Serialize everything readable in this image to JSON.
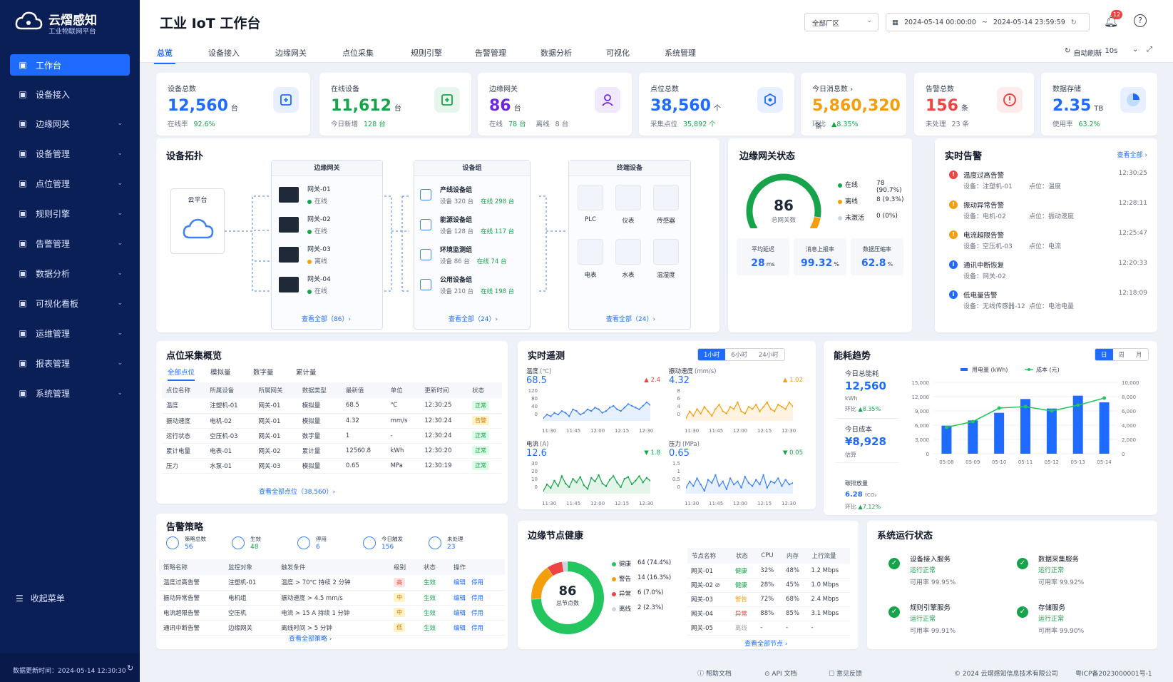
{
  "brand": {
    "name": "云熠感知",
    "subtitle": "工业物联网平台"
  },
  "sidebar": {
    "items": [
      {
        "label": "工作台",
        "icon": "dashboard-icon",
        "active": true
      },
      {
        "label": "设备接入",
        "icon": "device-access-icon"
      },
      {
        "label": "边缘网关",
        "icon": "gateway-icon",
        "chevron": true
      },
      {
        "label": "设备管理",
        "icon": "device-manage-icon",
        "chevron": true
      },
      {
        "label": "点位管理",
        "icon": "point-icon",
        "chevron": true
      },
      {
        "label": "规则引擎",
        "icon": "rule-icon",
        "chevron": true
      },
      {
        "label": "告警管理",
        "icon": "alarm-icon",
        "chevron": true
      },
      {
        "label": "数据分析",
        "icon": "analysis-icon",
        "chevron": true
      },
      {
        "label": "可视化看板",
        "icon": "board-icon",
        "chevron": true
      },
      {
        "label": "运维管理",
        "icon": "ops-icon",
        "chevron": true
      },
      {
        "label": "报表管理",
        "icon": "report-icon",
        "chevron": true
      },
      {
        "label": "系统管理",
        "icon": "settings-icon",
        "chevron": true
      }
    ],
    "collapse_label": "收起菜单",
    "update_time": "数据更新时间：2024-05-14 12:30:30"
  },
  "header": {
    "title": "工业 IoT 工作台",
    "factory_select": "全部厂区",
    "date_start": "2024-05-14 00:00:00",
    "date_sep": "~",
    "date_end": "2024-05-14 23:59:59",
    "notif_count": "12"
  },
  "tabs": [
    "总览",
    "设备接入",
    "边缘网关",
    "点位采集",
    "规则引擎",
    "告警管理",
    "数据分析",
    "可视化",
    "系统管理"
  ],
  "refresh": {
    "label": "自动刷新",
    "interval": "10s"
  },
  "stats": [
    {
      "label": "设备总数",
      "value": "12,560",
      "unit": "台",
      "sub1": "在线率",
      "sub1v": "92.6%",
      "sub2": "",
      "sub2v": "",
      "color": "#1f6bff",
      "icon": "device-icon"
    },
    {
      "label": "在线设备",
      "value": "11,612",
      "unit": "台",
      "sub1": "今日新增",
      "sub1v": "128 台",
      "sub2": "",
      "sub2v": "",
      "color": "#16a34a",
      "icon": "online-icon"
    },
    {
      "label": "边缘网关",
      "value": "86",
      "unit": "台",
      "sub1": "在线",
      "sub1v": "78 台",
      "sub2": "离线",
      "sub2v": "8 台",
      "color": "#6d28d9",
      "icon": "gateway-user-icon"
    },
    {
      "label": "点位总数",
      "value": "38,560",
      "unit": "个",
      "sub1": "采集点位",
      "sub1v": "35,892 个",
      "sub2": "",
      "sub2v": "",
      "color": "#1f6bff",
      "icon": "point-hex-icon"
    },
    {
      "label": "今日消息数 ›",
      "value": "5,860,320",
      "unit": "条",
      "sub1": "环比",
      "sub1v": "▲8.35%",
      "sub2": "",
      "sub2v": "",
      "color": "#f59e0b",
      "icon": ""
    },
    {
      "label": "告警总数",
      "value": "156",
      "unit": "条",
      "sub1": "未处理",
      "sub1v": "23 条",
      "sub2": "",
      "sub2v": "",
      "color": "#ef4444",
      "icon": "alert-circle-icon"
    },
    {
      "label": "数据存储",
      "value": "2.35",
      "unit": "TB",
      "sub1": "使用率",
      "sub1v": "63.2%",
      "sub2": "",
      "sub2v": "",
      "color": "#1f6bff",
      "icon": "storage-pie-icon"
    }
  ],
  "topology": {
    "title": "设备拓扑",
    "cloud": "云平台",
    "gateway_head": "边缘网关",
    "gateways": [
      {
        "name": "网关-01",
        "status": "在线",
        "color": "#16a34a"
      },
      {
        "name": "网关-02",
        "status": "在线",
        "color": "#16a34a"
      },
      {
        "name": "网关-03",
        "status": "离线",
        "color": "#f59e0b"
      },
      {
        "name": "网关-04",
        "status": "在线",
        "color": "#16a34a"
      }
    ],
    "gateway_link": "查看全部（86）›",
    "group_head": "设备组",
    "groups": [
      {
        "name": "产线设备组",
        "dev": "设备 320 台",
        "online": "在线 298 台"
      },
      {
        "name": "能源设备组",
        "dev": "设备 128 台",
        "online": "在线 117 台"
      },
      {
        "name": "环境监测组",
        "dev": "设备 86 台",
        "online": "在线 74 台"
      },
      {
        "name": "公用设备组",
        "dev": "设备 210 台",
        "online": "在线 198 台"
      }
    ],
    "group_link": "查看全部（24）›",
    "terminal_head": "终端设备",
    "terminals": [
      "PLC",
      "仪表",
      "传感器",
      "电表",
      "水表",
      "温湿度"
    ],
    "terminal_link": "查看全部（24）›"
  },
  "gw_status": {
    "title": "边缘网关状态",
    "total": "86",
    "total_label": "总网关数",
    "legend": [
      {
        "label": "在线",
        "value": "78 (90.7%)",
        "color": "#16a34a"
      },
      {
        "label": "离线",
        "value": "8 (9.3%)",
        "color": "#f59e0b"
      },
      {
        "label": "未激活",
        "value": "0 (0%)",
        "color": "#cbd5e1"
      }
    ],
    "online_fraction": 0.907,
    "metrics": [
      {
        "label": "平均延迟",
        "value": "28",
        "unit": "ms"
      },
      {
        "label": "消息上报率",
        "value": "99.32",
        "unit": "%"
      },
      {
        "label": "数据压缩率",
        "value": "62.8",
        "unit": "%"
      }
    ]
  },
  "alarms": {
    "title": "实时告警",
    "more": "查看全部 ›",
    "items": [
      {
        "title": "温度过高告警",
        "device": "设备：注塑机-01",
        "point": "点位：温度",
        "time": "12:30:25",
        "color": "#ef4444",
        "sym": "!"
      },
      {
        "title": "振动异常告警",
        "device": "设备：电机-02",
        "point": "点位：振动速度",
        "time": "12:28:11",
        "color": "#f59e0b",
        "sym": "!"
      },
      {
        "title": "电流超限告警",
        "device": "设备：空压机-03",
        "point": "点位：电流",
        "time": "12:25:47",
        "color": "#f59e0b",
        "sym": "!"
      },
      {
        "title": "通讯中断恢复",
        "device": "设备：网关-02",
        "point": "",
        "time": "12:20:33",
        "color": "#1f6bff",
        "sym": "i"
      },
      {
        "title": "低电量告警",
        "device": "设备：无线传感器-12",
        "point": "点位：电池电量",
        "time": "12:18:09",
        "color": "#1f6bff",
        "sym": "i"
      }
    ]
  },
  "points": {
    "title": "点位采集概览",
    "tabs": [
      "全部点位",
      "模拟量",
      "数字量",
      "累计量"
    ],
    "headers": [
      "点位名称",
      "所属设备",
      "所属网关",
      "数据类型",
      "最新值",
      "单位",
      "更新时间",
      "状态"
    ],
    "rows": [
      [
        "温度",
        "注塑机-01",
        "网关-01",
        "模拟量",
        "68.5",
        "℃",
        "12:30:25",
        "正常"
      ],
      [
        "振动速度",
        "电机-02",
        "网关-01",
        "模拟量",
        "4.32",
        "mm/s",
        "12:30:24",
        "告警"
      ],
      [
        "运行状态",
        "空压机-03",
        "网关-01",
        "数字量",
        "1",
        "-",
        "12:30:24",
        "正常"
      ],
      [
        "累计电量",
        "电表-01",
        "网关-02",
        "累计量",
        "12560.8",
        "kWh",
        "12:30:20",
        "正常"
      ],
      [
        "压力",
        "水泵-01",
        "网关-03",
        "模拟量",
        "0.65",
        "MPa",
        "12:30:19",
        "正常"
      ]
    ],
    "more": "查看全部点位（38,560）›"
  },
  "telemetry": {
    "title": "实时遥测",
    "ranges": [
      "1小时",
      "6小时",
      "24小时"
    ],
    "charts": [
      {
        "label": "温度",
        "unit": "(℃)",
        "value": "68.5",
        "delta": "▲ 2.4",
        "dcolor": "#ef4444",
        "color": "#3b82f6",
        "yticks": [
          "120",
          "80",
          "40",
          "0"
        ],
        "x": [
          "11:30",
          "11:45",
          "12:00",
          "12:15",
          "12:30"
        ],
        "values": [
          61,
          63,
          62,
          64,
          63,
          65,
          64,
          62,
          66,
          65,
          63,
          64,
          66,
          65,
          67,
          66,
          64,
          65,
          67,
          68,
          66,
          65,
          67,
          69,
          68,
          67,
          66,
          68,
          70,
          68.5
        ]
      },
      {
        "label": "振动速度",
        "unit": "(mm/s)",
        "value": "4.32",
        "delta": "▲ 1.02",
        "dcolor": "#f59e0b",
        "color": "#f59e0b",
        "yticks": [
          "8",
          "6",
          "4",
          "0"
        ],
        "x": [
          "11:30",
          "11:45",
          "12:00",
          "12:15",
          "12:30"
        ],
        "values": [
          3.8,
          4.1,
          3.9,
          4.2,
          4.0,
          4.3,
          4.1,
          3.9,
          4.2,
          4.4,
          4.1,
          4.0,
          4.3,
          4.2,
          4.5,
          4.1,
          4.0,
          4.3,
          4.2,
          4.4,
          4.1,
          4.3,
          4.5,
          4.2,
          4.1,
          4.4,
          4.3,
          4.2,
          4.5,
          4.32
        ]
      },
      {
        "label": "电流",
        "unit": "(A)",
        "value": "12.6",
        "delta": "▼ 1.8",
        "dcolor": "#16a34a",
        "color": "#16a34a",
        "yticks": [
          "30",
          "20",
          "10",
          "0"
        ],
        "x": [
          "11:30",
          "11:45",
          "12:00",
          "12:15",
          "12:30"
        ],
        "values": [
          11.5,
          12.2,
          11.8,
          12.6,
          12.0,
          13.1,
          12.3,
          11.9,
          12.8,
          12.4,
          13.0,
          12.1,
          11.7,
          12.9,
          12.5,
          13.2,
          12.3,
          12.0,
          12.7,
          13.1,
          12.4,
          11.9,
          12.8,
          13.0,
          12.2,
          12.6,
          13.1,
          12.4,
          12.9,
          12.6
        ]
      },
      {
        "label": "压力",
        "unit": "(MPa)",
        "value": "0.65",
        "delta": "▼ 0.05",
        "dcolor": "#16a34a",
        "color": "#3b82f6",
        "yticks": [
          "1.5",
          "1",
          "0.5",
          "0"
        ],
        "x": [
          "11:30",
          "11:45",
          "12:00",
          "12:15",
          "12:30"
        ],
        "values": [
          0.62,
          0.66,
          0.63,
          0.68,
          0.64,
          0.6,
          0.67,
          0.65,
          0.7,
          0.63,
          0.66,
          0.61,
          0.68,
          0.64,
          0.66,
          0.62,
          0.69,
          0.65,
          0.63,
          0.67,
          0.64,
          0.7,
          0.62,
          0.66,
          0.65,
          0.68,
          0.63,
          0.67,
          0.64,
          0.65
        ]
      }
    ]
  },
  "energy": {
    "title": "能耗趋势",
    "ranges": [
      "日",
      "周",
      "月"
    ],
    "today_label": "今日总能耗",
    "today_value": "12,560",
    "today_unit": "kWh",
    "today_ratio_label": "环比",
    "today_ratio": "▲8.35%",
    "cost_label": "今日成本",
    "cost_value": "¥8,928",
    "cost_unit": "估算",
    "carbon_label": "碳排放量",
    "carbon_value": "6.28",
    "carbon_unit": "tCO₂",
    "carbon_ratio_label": "环比",
    "carbon_ratio": "▲7.12%",
    "legend": [
      "用电量 (kWh)",
      "成本 (元)"
    ]
  },
  "chart_data": {
    "type": "bar",
    "categories": [
      "05-08",
      "05-09",
      "05-10",
      "05-11",
      "05-12",
      "05-13",
      "05-14"
    ],
    "series": [
      {
        "name": "用电量 (kWh)",
        "type": "bar",
        "values": [
          5900,
          7000,
          8600,
          11500,
          9500,
          12200,
          10800
        ]
      },
      {
        "name": "成本 (元)",
        "type": "line",
        "values": [
          3700,
          4500,
          6400,
          6600,
          6000,
          6800,
          7800
        ]
      }
    ],
    "y_left_ticks": [
      "15,000",
      "12,000",
      "9,000",
      "6,000",
      "3,000",
      "0"
    ],
    "y_right_ticks": [
      "10,000",
      "8,000",
      "6,000",
      "4,000",
      "2,000",
      "0"
    ],
    "ylim": [
      0,
      15000
    ],
    "y2lim": [
      0,
      10000
    ]
  },
  "strategy": {
    "title": "告警策略",
    "summary": [
      {
        "label": "策略总数",
        "value": "56",
        "icon": "strategy-icon"
      },
      {
        "label": "生效",
        "value": "48",
        "icon": "effective-icon"
      },
      {
        "label": "停用",
        "value": "6",
        "icon": "disabled-icon"
      },
      {
        "label": "今日触发",
        "value": "156",
        "icon": "trigger-icon"
      },
      {
        "label": "未处理",
        "value": "23",
        "icon": "pending-icon"
      }
    ],
    "headers": [
      "策略名称",
      "监控对象",
      "触发条件",
      "级别",
      "状态",
      "操作"
    ],
    "rows": [
      [
        "温度过高告警",
        "注塑机-01",
        "温度 > 70℃ 持续 2 分钟",
        "高",
        "生效"
      ],
      [
        "振动异常告警",
        "电机组",
        "振动速度 > 4.5 mm/s",
        "中",
        "生效"
      ],
      [
        "电流超限告警",
        "空压机",
        "电流 > 15 A 持续 1 分钟",
        "中",
        "生效"
      ],
      [
        "通讯中断告警",
        "边缘网关",
        "离线时间 > 5 分钟",
        "低",
        "生效"
      ]
    ],
    "edit": "编辑",
    "stop": "停用",
    "more": "查看全部策略 ›"
  },
  "edge_health": {
    "title": "边缘节点健康",
    "total": "86",
    "total_label": "总节点数",
    "legend": [
      {
        "label": "健康",
        "value": "64 (74.4%)",
        "color": "#22c55e",
        "fraction": 0.744
      },
      {
        "label": "警告",
        "value": "14 (16.3%)",
        "color": "#f59e0b",
        "fraction": 0.163
      },
      {
        "label": "异常",
        "value": "6 (7.0%)",
        "color": "#ef4444",
        "fraction": 0.07
      },
      {
        "label": "离线",
        "value": "2 (2.3%)",
        "color": "#cbd5e1",
        "fraction": 0.023
      }
    ],
    "headers": [
      "节点名称",
      "状态",
      "CPU",
      "内存",
      "上行流量"
    ],
    "rows": [
      [
        "网关-01",
        "健康",
        "32%",
        "48%",
        "1.2 Mbps"
      ],
      [
        "网关-02 ⊘",
        "健康",
        "28%",
        "45%",
        "1.0 Mbps"
      ],
      [
        "网关-03",
        "警告",
        "72%",
        "68%",
        "2.4 Mbps"
      ],
      [
        "网关-04",
        "异常",
        "88%",
        "85%",
        "3.1 Mbps"
      ],
      [
        "网关-05",
        "离线",
        "-",
        "-",
        "-"
      ]
    ],
    "more": "查看全部节点 ›"
  },
  "sys_status": {
    "title": "系统运行状态",
    "items": [
      {
        "name": "设备接入服务",
        "status": "运行正常",
        "avail": "可用率  99.95%"
      },
      {
        "name": "数据采集服务",
        "status": "运行正常",
        "avail": "可用率  99.92%"
      },
      {
        "name": "规则引擎服务",
        "status": "运行正常",
        "avail": "可用率  99.91%"
      },
      {
        "name": "存储服务",
        "status": "运行正常",
        "avail": "可用率  99.90%"
      }
    ]
  },
  "footer": {
    "help": "帮助文档",
    "api": "API 文档",
    "feedback": "意见反馈",
    "copyright": "© 2024 云熠感知信息技术有限公司",
    "icp": "粤ICP备2023000001号-1"
  }
}
